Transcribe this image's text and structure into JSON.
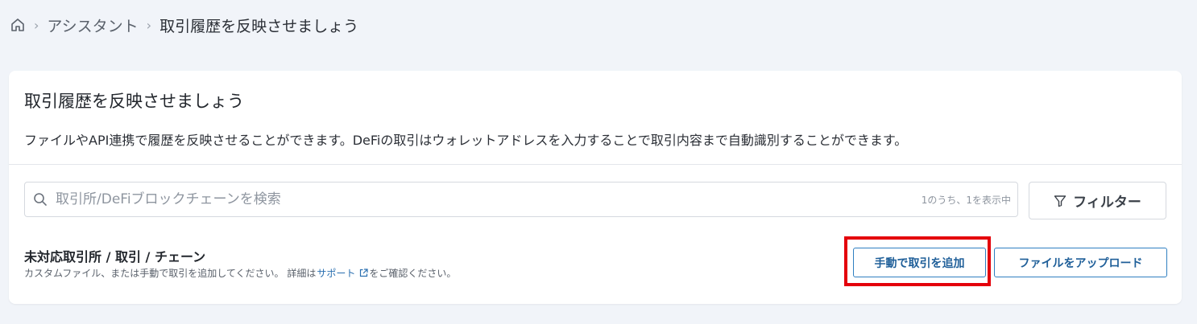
{
  "breadcrumb": {
    "home_icon": "home-icon",
    "items": [
      "アシスタント",
      "取引履歴を反映させましょう"
    ],
    "separator": "›"
  },
  "card": {
    "title": "取引履歴を反映させましょう",
    "description": "ファイルやAPI連携で履歴を反映させることができます。DeFiの取引はウォレットアドレスを入力することで取引内容まで自動識別することができます。"
  },
  "search": {
    "icon": "search-icon",
    "placeholder": "取引所/DeFiブロックチェーンを検索",
    "value": "",
    "result_count": "1のうち、1を表示中"
  },
  "filter": {
    "icon": "funnel-icon",
    "label": "フィルター"
  },
  "unsupported": {
    "title": "未対応取引所 / 取引 / チェーン",
    "note_before": "カスタムファイル、または手動で取引を追加してください。 詳細は",
    "link_label": "サポート",
    "link_icon": "external-link-icon",
    "note_after": "をご確認ください。"
  },
  "actions": {
    "manual_add_label": "手動で取引を追加",
    "upload_label": "ファイルをアップロード"
  },
  "colors": {
    "accent": "#2f7fc1",
    "highlight": "#e4000b",
    "background": "#f1f4f9"
  }
}
